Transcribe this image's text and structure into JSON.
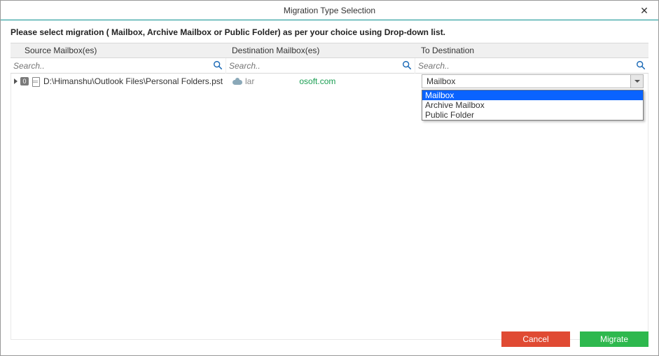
{
  "window": {
    "title": "Migration Type Selection"
  },
  "instruction": "Please select migration ( Mailbox, Archive Mailbox or Public Folder) as per your choice using Drop-down list.",
  "columns": {
    "source": "Source Mailbox(es)",
    "dest": "Destination Mailbox(es)",
    "todest": "To Destination"
  },
  "search": {
    "placeholder": "Search..",
    "source_value": "",
    "dest_value": "",
    "todest_value": ""
  },
  "row": {
    "badge": "0",
    "source_path": "D:\\Himanshu\\Outlook Files\\Personal Folders.pst",
    "dest_left": "lar",
    "dest_right": "osoft.com",
    "selected": "Mailbox"
  },
  "dropdown": {
    "options": [
      "Mailbox",
      "Archive Mailbox",
      "Public Folder"
    ],
    "highlighted": "Mailbox"
  },
  "buttons": {
    "cancel": "Cancel",
    "migrate": "Migrate"
  }
}
